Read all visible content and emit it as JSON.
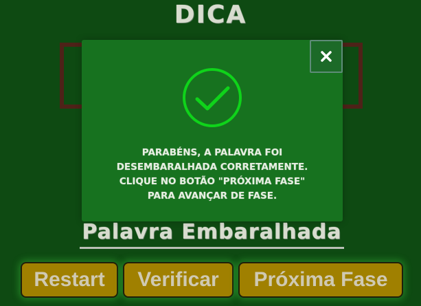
{
  "hint": {
    "title": "DICA"
  },
  "scrambled_word": {
    "text": "Palavra Embaralhada"
  },
  "buttons": {
    "restart": "Restart",
    "verify": "Verificar",
    "next_phase": "Próxima Fase"
  },
  "modal": {
    "close_icon": "close-icon",
    "status_icon": "check-circle-icon",
    "message": "PARABÉNS, A PALAVRA FOI\nDESEMBARALHADA CORRETAMENTE.\nCLIQUE NO BOTÃO \"PRÓXIMA FASE\"\nPARA AVANÇAR DE FASE."
  },
  "colors": {
    "background": "#0e4a12",
    "board_frame": "#4e2218",
    "modal_background": "#17721f",
    "check_green": "#0fd31a",
    "button": "#a08000",
    "button_glow": "#46dc46",
    "chalk_text": "#d8dccf"
  }
}
